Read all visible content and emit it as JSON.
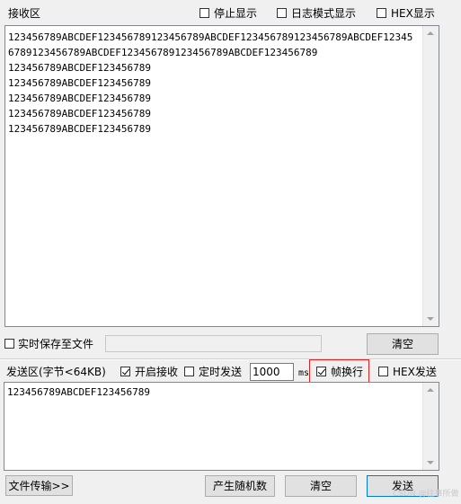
{
  "receive": {
    "title": "接收区",
    "stop_display": "停止显示",
    "log_mode": "日志模式显示",
    "hex_display": "HEX显示",
    "lines": [
      "123456789ABCDEF123456789123456789ABCDEF123456789123456789ABCDEF12345",
      "6789123456789ABCDEF123456789123456789ABCDEF123456789",
      "123456789ABCDEF123456789",
      "123456789ABCDEF123456789",
      "123456789ABCDEF123456789",
      "123456789ABCDEF123456789",
      "123456789ABCDEF123456789"
    ],
    "realtime_save": "实时保存至文件",
    "clear_label": "清空"
  },
  "send": {
    "title": "发送区(字节<64KB)",
    "enable_receive": "开启接收",
    "timed_send": "定时发送",
    "interval_value": "1000",
    "interval_unit": "ms",
    "frame_newline": "帧换行",
    "hex_send": "HEX发送",
    "content": "123456789ABCDEF123456789"
  },
  "footer": {
    "file_transfer": "文件传输>>",
    "random_gen": "产生随机数",
    "clear": "清空",
    "send": "发送"
  },
  "watermark": "CSDN @往事所做",
  "highlight_color": "#e0201b"
}
